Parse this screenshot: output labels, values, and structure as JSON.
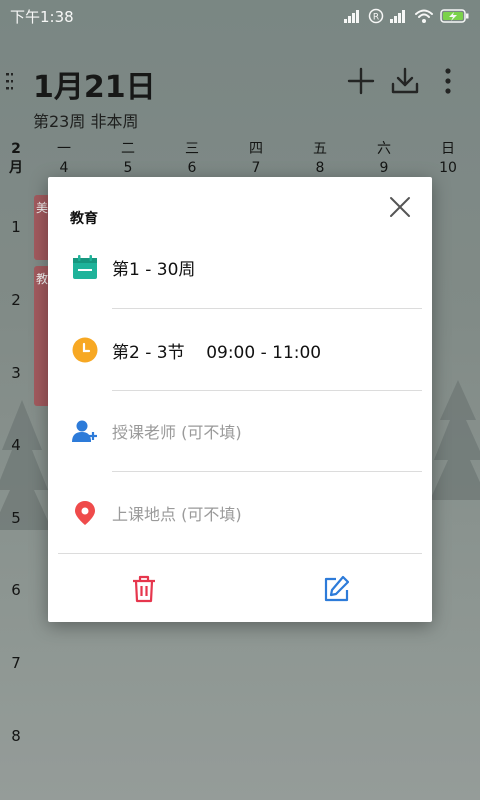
{
  "status_bar": {
    "time": "下午1:38",
    "icons": [
      "signal-icon",
      "roaming-icon",
      "signal-icon",
      "wifi-icon",
      "battery-charging-icon"
    ],
    "roaming_letter": "R"
  },
  "header": {
    "date": "1月21日",
    "week_info": "第23周  非本周",
    "actions": [
      "menu-icon",
      "add-icon",
      "download-icon",
      "more-icon"
    ]
  },
  "week": {
    "month_num": "2",
    "month_unit": "月",
    "days": [
      {
        "name": "一",
        "date": "4"
      },
      {
        "name": "二",
        "date": "5"
      },
      {
        "name": "三",
        "date": "6"
      },
      {
        "name": "四",
        "date": "7"
      },
      {
        "name": "五",
        "date": "8"
      },
      {
        "name": "六",
        "date": "9"
      },
      {
        "name": "日",
        "date": "10"
      }
    ]
  },
  "periods": [
    "1",
    "2",
    "3",
    "4",
    "5",
    "6",
    "7",
    "8"
  ],
  "courses_partial": [
    "美",
    "教"
  ],
  "colors": {
    "week_icon": "#1fb39a",
    "time_icon": "#f7a823",
    "teacher_icon": "#2d7bd9",
    "location_icon": "#ef4b4b",
    "delete_icon": "#e6364d",
    "edit_icon": "#2d7bd9",
    "course_block": "#a75a5f"
  },
  "dialog": {
    "title": "教育",
    "weeks": "第1 - 30周",
    "time": "第2 - 3节    09:00 - 11:00",
    "teacher_placeholder": "授课老师 (可不填)",
    "location_placeholder": "上课地点 (可不填)",
    "icons": {
      "close": "close-icon",
      "weeks": "calendar-icon",
      "time": "clock-icon",
      "teacher": "person-add-icon",
      "location": "location-pin-icon",
      "delete": "trash-icon",
      "edit": "edit-icon"
    }
  }
}
